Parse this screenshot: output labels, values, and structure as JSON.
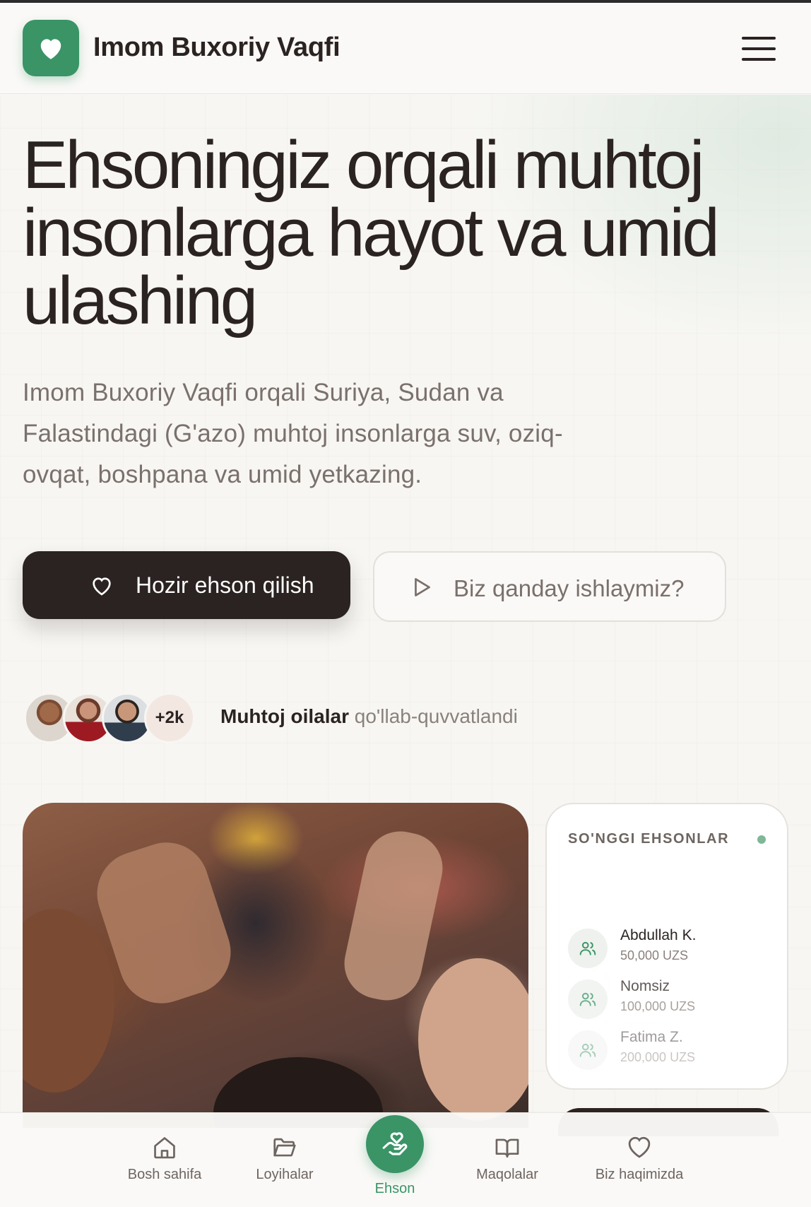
{
  "header": {
    "brand": "Imom Buxoriy Vaqfi",
    "logo_icon": "heart-icon",
    "menu_icon": "hamburger-menu-icon"
  },
  "hero": {
    "title": "Ehsoningiz orqali muhtoj insonlarga hayot va umid ulashing",
    "subtitle": "Imom Buxoriy Vaqfi orqali Suriya, Sudan va Falastindagi (G'azo) muhtoj insonlarga suv, oziq-ovqat, boshpana va umid yetkazing.",
    "primary_button": "Hozir ehson qilish",
    "secondary_button": "Biz qanday ishlaymiz?"
  },
  "social_proof": {
    "count_badge": "+2k",
    "bold_text": "Muhtoj oilalar",
    "rest_text": "qo'llab-quvvatlandi"
  },
  "recent_donations": {
    "title": "SO'NGGI EHSONLAR",
    "items": [
      {
        "name": "Abdullah K.",
        "amount": "50,000 UZS"
      },
      {
        "name": "Nomsiz",
        "amount": "100,000 UZS"
      },
      {
        "name": "Fatima Z.",
        "amount": "200,000 UZS"
      }
    ]
  },
  "tabbar": {
    "items": [
      {
        "label": "Bosh sahifa",
        "icon": "home-icon"
      },
      {
        "label": "Loyihalar",
        "icon": "folder-icon"
      },
      {
        "label": "Ehson",
        "icon": "hand-heart-icon"
      },
      {
        "label": "Maqolalar",
        "icon": "book-icon"
      },
      {
        "label": "Biz haqimizda",
        "icon": "heart-icon"
      }
    ]
  },
  "colors": {
    "brand_green": "#3a9466",
    "dark": "#2b2321",
    "muted_text": "#7a706c",
    "background": "#f7f6f3"
  }
}
